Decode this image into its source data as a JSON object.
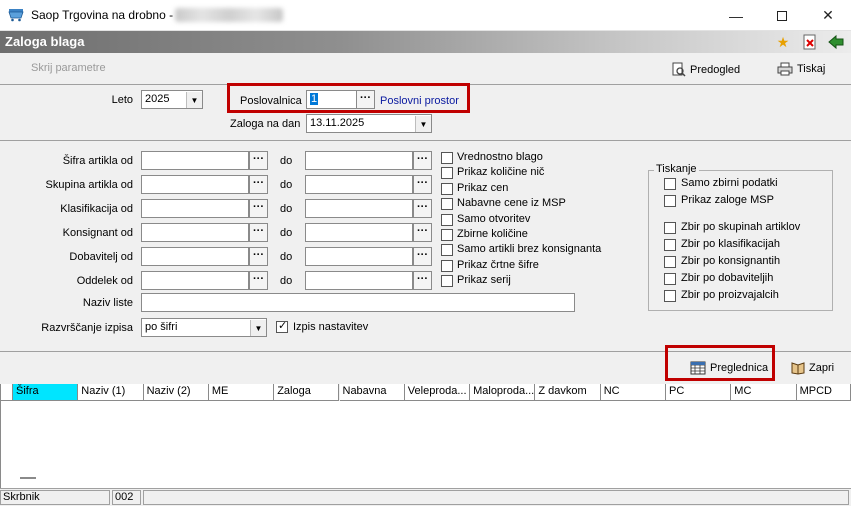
{
  "window": {
    "title": "Saop Trgovina na drobno - "
  },
  "header": {
    "title": "Zaloga blaga"
  },
  "toolbar": {
    "hide_params": "Skrij parametre",
    "preview": "Predogled",
    "print": "Tiskaj"
  },
  "form": {
    "leto_label": "Leto",
    "leto_value": "2025",
    "poslovalnica_label": "Poslovalnica",
    "poslovalnica_value": "1",
    "poslovni_prostor": "Poslovni prostor",
    "zaloga_label": "Zaloga na dan",
    "zaloga_value": "13.11.2025",
    "do_label": "do",
    "ranges": [
      {
        "label": "Šifra artikla od"
      },
      {
        "label": "Skupina artikla od"
      },
      {
        "label": "Klasifikacija od"
      },
      {
        "label": "Konsignant od"
      },
      {
        "label": "Dobavitelj od"
      },
      {
        "label": "Oddelek od"
      }
    ],
    "naziv_label": "Naziv liste",
    "sort_label": "Razvrščanje izpisa",
    "sort_value": "po šifri",
    "izpis_nastavitev": "Izpis nastavitev"
  },
  "options": [
    "Vrednostno blago",
    "Prikaz količine nič",
    "Prikaz cen",
    "Nabavne cene iz MSP",
    "Samo otvoritev",
    "Zbirne količine",
    "Samo artikli brez konsignanta",
    "Prikaz črtne šifre",
    "Prikaz serij"
  ],
  "tiskanje": {
    "title": "Tiskanje",
    "items_a": [
      "Samo zbirni podatki",
      "Prikaz zaloge MSP"
    ],
    "items_b": [
      "Zbir po skupinah artiklov",
      "Zbir po klasifikacijah",
      "Zbir po konsignantih",
      "Zbir po dobaviteljih",
      "Zbir po proizvajalcih"
    ]
  },
  "actions": {
    "preglednica": "Preglednica",
    "zapri": "Zapri"
  },
  "grid": {
    "columns": [
      "Šifra",
      "Naziv (1)",
      "Naziv (2)",
      "ME",
      "Zaloga",
      "Nabavna",
      "Veleproda...",
      "Maloproda...",
      "Z davkom",
      "NC",
      "PC",
      "MC",
      "MPCD"
    ]
  },
  "status": {
    "user": "Skrbnik",
    "code": "002"
  }
}
